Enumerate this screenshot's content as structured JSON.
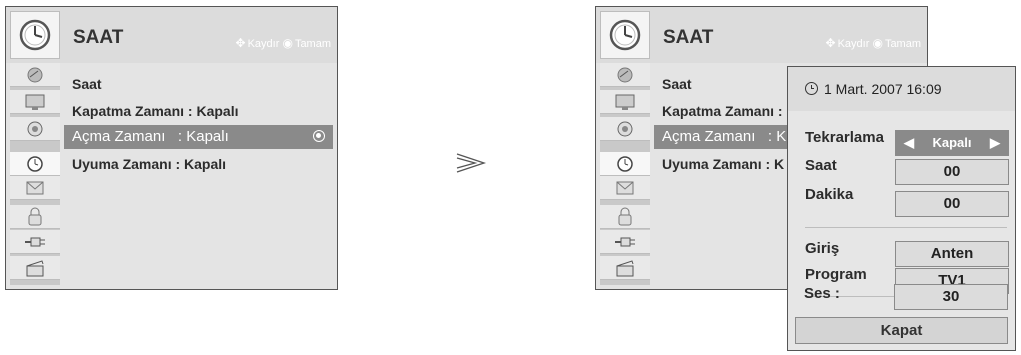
{
  "left": {
    "title": "SAAT",
    "hint_move": "Kaydır",
    "hint_ok": "Tamam",
    "items": [
      {
        "label": "Saat"
      },
      {
        "label": "Kapatma Zamanı : Kapalı"
      },
      {
        "label": "Açma Zamanı",
        "value": ": Kapalı"
      },
      {
        "label": "Uyuma Zamanı : Kapalı"
      }
    ]
  },
  "right": {
    "title": "SAAT",
    "hint_move": "Kaydır",
    "hint_ok": "Tamam",
    "items": [
      {
        "label": "Saat"
      },
      {
        "label": "Kapatma Zamanı : K"
      },
      {
        "label": "Açma Zamanı",
        "value": ": K"
      },
      {
        "label": "Uyuma Zamanı : K"
      }
    ]
  },
  "popup": {
    "date": "1 Mart. 2007 16:09",
    "repeat_label": "Tekrarlama",
    "repeat_value": "Kapalı",
    "hour_label": "Saat",
    "hour_value": "00",
    "minute_label": "Dakika",
    "minute_value": "00",
    "input_label": "Giriş",
    "input_value": "Anten",
    "program_label": "Program",
    "program_value": "TV1",
    "volume_label": "Ses :",
    "volume_value": "30",
    "close_label": "Kapat"
  },
  "sidebar_icons": [
    "satellite-icon",
    "monitor-icon",
    "speaker-icon",
    "clock-icon",
    "envelope-icon",
    "lock-icon",
    "plug-icon",
    "clapperboard-icon"
  ],
  "colors": {
    "selected": "#8a8a8a",
    "panel": "#e4e4e4"
  }
}
